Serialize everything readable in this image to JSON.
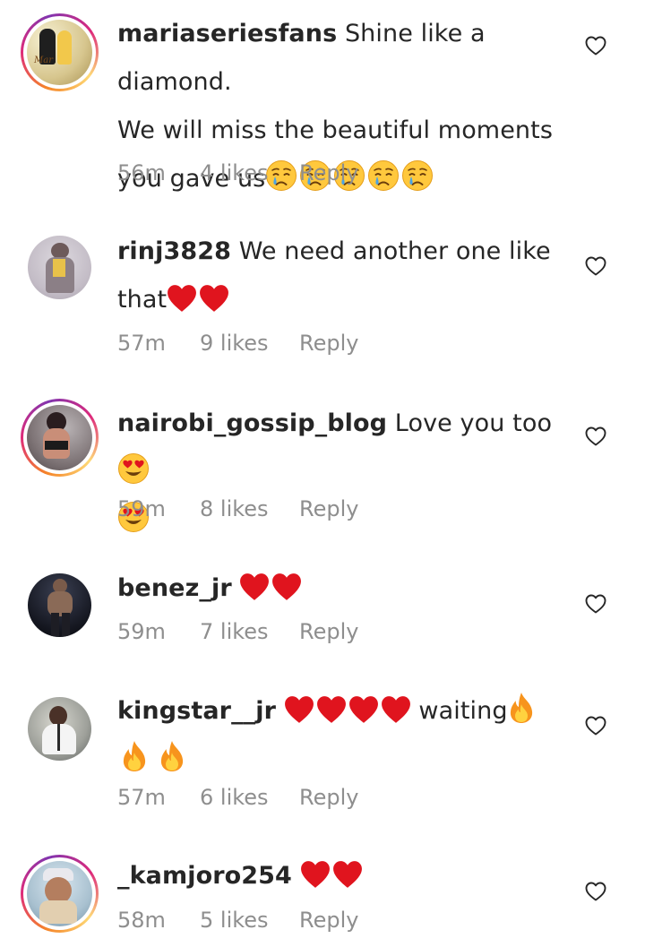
{
  "comments": [
    {
      "username": "mariaseriesfans",
      "text_line1": "Shine like a diamond.",
      "text_line2": "We will miss the beautiful moments",
      "text_line3": "you gave us",
      "emojis": [
        "crying-face",
        "crying-face",
        "crying-face",
        "crying-face",
        "crying-face"
      ],
      "time": "56m",
      "likes": "4 likes",
      "reply": "Reply",
      "has_story_ring": true
    },
    {
      "username": "rinj3828",
      "text_line1": "We need another one like",
      "text_line2": "that",
      "emojis": [
        "red-heart",
        "red-heart"
      ],
      "time": "57m",
      "likes": "9 likes",
      "reply": "Reply",
      "has_story_ring": false
    },
    {
      "username": "nairobi_gossip_blog",
      "text_line1": "Love you too",
      "emojis_line1": [
        "heart-eyes"
      ],
      "emojis_line2": [
        "heart-eyes"
      ],
      "time": "59m",
      "likes": "8 likes",
      "reply": "Reply",
      "has_story_ring": true
    },
    {
      "username": "benez_jr",
      "emojis": [
        "red-heart",
        "red-heart"
      ],
      "time": "59m",
      "likes": "7 likes",
      "reply": "Reply",
      "has_story_ring": false
    },
    {
      "username": "kingstar__jr",
      "emojis_before": [
        "red-heart",
        "red-heart",
        "red-heart",
        "red-heart"
      ],
      "text_line1": "waiting",
      "emojis_line1": [
        "fire"
      ],
      "emojis_line2": [
        "fire",
        "fire"
      ],
      "time": "57m",
      "likes": "6 likes",
      "reply": "Reply",
      "has_story_ring": false
    },
    {
      "username": "_kamjoro254",
      "emojis": [
        "red-heart",
        "red-heart"
      ],
      "time": "58m",
      "likes": "5 likes",
      "reply": "Reply",
      "has_story_ring": true
    }
  ],
  "colors": {
    "text": "#262626",
    "meta": "#8e8e8e",
    "heart_emoji": "#e0141e",
    "emoji_yellow": "#ffc83d"
  },
  "icons": {
    "like": "heart-outline-icon"
  }
}
